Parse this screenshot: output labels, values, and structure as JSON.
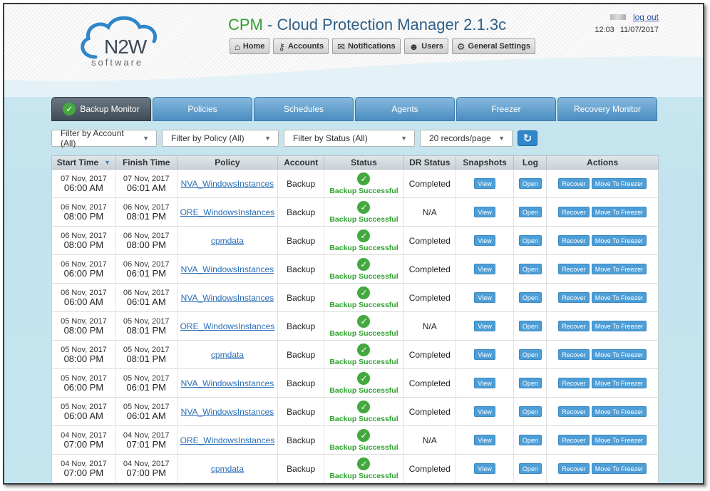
{
  "header": {
    "title_brand": "CPM",
    "title_rest": " - Cloud Protection Manager 2.1.3c",
    "logo_text": "N2W",
    "logo_sub": "software"
  },
  "nav": [
    {
      "label": "Home",
      "icon": "home-icon"
    },
    {
      "label": "Accounts",
      "icon": "key-icon"
    },
    {
      "label": "Notifications",
      "icon": "envelope-icon"
    },
    {
      "label": "Users",
      "icon": "users-icon"
    },
    {
      "label": "General Settings",
      "icon": "gear-icon"
    }
  ],
  "user": {
    "logout": "log out",
    "time": "12:03",
    "date": "11/07/2017"
  },
  "tabs": [
    "Backup Monitor",
    "Policies",
    "Schedules",
    "Agents",
    "Freezer",
    "Recovery Monitor"
  ],
  "filters": {
    "account": "Filter by Account (All)",
    "policy": "Filter by Policy (All)",
    "status": "Filter by Status (All)",
    "records": "20 records/page"
  },
  "columns": [
    "Start Time",
    "Finish Time",
    "Policy",
    "Account",
    "Status",
    "DR Status",
    "Snapshots",
    "Log",
    "Actions"
  ],
  "buttons": {
    "view": "View",
    "open": "Open",
    "recover": "Recover",
    "freezer": "Move To Freezer"
  },
  "rows": [
    {
      "start_date": "07 Nov, 2017",
      "start_time": "06:00 AM",
      "finish_date": "07 Nov, 2017",
      "finish_time": "06:01 AM",
      "policy": "NVA_WindowsInstances",
      "account": "Backup",
      "status": "Backup Successful",
      "dr": "Completed"
    },
    {
      "start_date": "06 Nov, 2017",
      "start_time": "08:00 PM",
      "finish_date": "06 Nov, 2017",
      "finish_time": "08:01 PM",
      "policy": "ORE_WindowsInstances",
      "account": "Backup",
      "status": "Backup Successful",
      "dr": "N/A"
    },
    {
      "start_date": "06 Nov, 2017",
      "start_time": "08:00 PM",
      "finish_date": "06 Nov, 2017",
      "finish_time": "08:00 PM",
      "policy": "cpmdata",
      "account": "Backup",
      "status": "Backup Successful",
      "dr": "Completed"
    },
    {
      "start_date": "06 Nov, 2017",
      "start_time": "06:00 PM",
      "finish_date": "06 Nov, 2017",
      "finish_time": "06:01 PM",
      "policy": "NVA_WindowsInstances",
      "account": "Backup",
      "status": "Backup Successful",
      "dr": "Completed"
    },
    {
      "start_date": "06 Nov, 2017",
      "start_time": "06:00 AM",
      "finish_date": "06 Nov, 2017",
      "finish_time": "06:01 AM",
      "policy": "NVA_WindowsInstances",
      "account": "Backup",
      "status": "Backup Successful",
      "dr": "Completed"
    },
    {
      "start_date": "05 Nov, 2017",
      "start_time": "08:00 PM",
      "finish_date": "05 Nov, 2017",
      "finish_time": "08:01 PM",
      "policy": "ORE_WindowsInstances",
      "account": "Backup",
      "status": "Backup Successful",
      "dr": "N/A"
    },
    {
      "start_date": "05 Nov, 2017",
      "start_time": "08:00 PM",
      "finish_date": "05 Nov, 2017",
      "finish_time": "08:01 PM",
      "policy": "cpmdata",
      "account": "Backup",
      "status": "Backup Successful",
      "dr": "Completed"
    },
    {
      "start_date": "05 Nov, 2017",
      "start_time": "06:00 PM",
      "finish_date": "05 Nov, 2017",
      "finish_time": "06:01 PM",
      "policy": "NVA_WindowsInstances",
      "account": "Backup",
      "status": "Backup Successful",
      "dr": "Completed"
    },
    {
      "start_date": "05 Nov, 2017",
      "start_time": "06:00 AM",
      "finish_date": "05 Nov, 2017",
      "finish_time": "06:01 AM",
      "policy": "NVA_WindowsInstances",
      "account": "Backup",
      "status": "Backup Successful",
      "dr": "Completed"
    },
    {
      "start_date": "04 Nov, 2017",
      "start_time": "07:00 PM",
      "finish_date": "04 Nov, 2017",
      "finish_time": "07:01 PM",
      "policy": "ORE_WindowsInstances",
      "account": "Backup",
      "status": "Backup Successful",
      "dr": "N/A"
    },
    {
      "start_date": "04 Nov, 2017",
      "start_time": "07:00 PM",
      "finish_date": "04 Nov, 2017",
      "finish_time": "07:00 PM",
      "policy": "cpmdata",
      "account": "Backup",
      "status": "Backup Successful",
      "dr": "Completed"
    }
  ]
}
